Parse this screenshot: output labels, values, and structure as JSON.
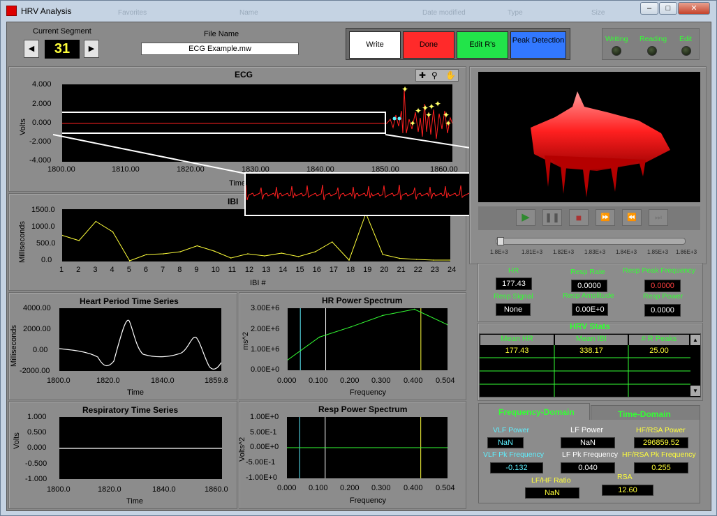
{
  "window": {
    "title": "HRV Analysis",
    "ghost": {
      "favorites": "Favorites",
      "name": "Name",
      "date": "Date modified",
      "type": "Type",
      "size": "Size"
    }
  },
  "top": {
    "current_segment_label": "Current Segment",
    "segment": "31",
    "file_name_label": "File Name",
    "file_name": "ECG Example.mw",
    "buttons": {
      "write": "Write",
      "done": "Done",
      "edit": "Edit R's",
      "peak": "Peak Detection"
    },
    "leds": {
      "writing": "Writing",
      "reading": "Reading",
      "edit": "Edit"
    }
  },
  "ecg": {
    "title": "ECG",
    "ylabel": "Volts",
    "xlabel": "Time",
    "yticks": [
      "4.000",
      "2.000",
      "0.000",
      "-2.000",
      "-4.000"
    ],
    "xticks": [
      "1800.00",
      "1810.00",
      "1820.00",
      "1830.00",
      "1840.00",
      "1850.00",
      "1860.00"
    ]
  },
  "ibi": {
    "title": "IBI",
    "ylabel": "Milliseconds",
    "xlabel": "IBI #",
    "yticks": [
      "1500.0",
      "1000.0",
      "500.0",
      "0.0"
    ]
  },
  "hp": {
    "title": "Heart Period Time Series",
    "ylabel": "Milliseconds",
    "xlabel": "Time",
    "yticks": [
      "4000.00",
      "2000.00",
      "0.00",
      "-2000.00"
    ],
    "xticks": [
      "1800.0",
      "1820.0",
      "1840.0",
      "1859.8"
    ]
  },
  "hrps": {
    "title": "HR Power Spectrum",
    "ylabel": "ms^2",
    "xlabel": "Frequency",
    "yticks": [
      "3.00E+6",
      "2.00E+6",
      "1.00E+6",
      "0.00E+0"
    ],
    "xticks": [
      "0.000",
      "0.100",
      "0.200",
      "0.300",
      "0.400",
      "0.504"
    ]
  },
  "resp": {
    "title": "Respiratory Time Series",
    "ylabel": "Volts",
    "xlabel": "Time",
    "yticks": [
      "1.000",
      "0.500",
      "0.000",
      "-0.500",
      "-1.000"
    ],
    "xticks": [
      "1800.0",
      "1820.0",
      "1840.0",
      "1860.0"
    ]
  },
  "rps": {
    "title": "Resp Power Spectrum",
    "ylabel": "Volts^2",
    "xlabel": "Frequency",
    "yticks": [
      "1.00E+0",
      "5.00E-1",
      "0.00E+0",
      "-5.00E-1",
      "-1.00E+0"
    ],
    "xticks": [
      "0.000",
      "0.100",
      "0.200",
      "0.300",
      "0.400",
      "0.504"
    ]
  },
  "slider": {
    "ticks": [
      "1.8E+3",
      "1.81E+3",
      "1.82E+3",
      "1.83E+3",
      "1.84E+3",
      "1.85E+3",
      "1.86E+3"
    ]
  },
  "metrics": {
    "hr_label": "HR",
    "hr": "177.43",
    "resp_rate_label": "Resp Rate",
    "resp_rate": "0.0000",
    "resp_peak_label": "Resp Peak Frequency",
    "resp_peak": "0.0000",
    "resp_signal_label": "Resp Signal",
    "resp_signal": "None",
    "resp_amp_label": "Resp Amplitude",
    "resp_amp": "0.00E+0",
    "resp_power_label": "Resp Power",
    "resp_power": "0.0000"
  },
  "hrv": {
    "title": "HRV Stats",
    "headers": [
      "Mean HR",
      "Mean IBI",
      "# R Peaks"
    ],
    "row": [
      "177.43",
      "338.17",
      "25.00"
    ]
  },
  "tabs": {
    "freq": "Frequency-Domain",
    "time": "Time-Domain"
  },
  "freq": {
    "vlf_power_label": "VLF  Power",
    "vlf_power": "NaN",
    "lf_power_label": "LF Power",
    "lf_power": "NaN",
    "hf_power_label": "HF/RSA Power",
    "hf_power": "296859.52",
    "vlf_pk_label": "VLF Pk Frequency",
    "vlf_pk": "-0.132",
    "lf_pk_label": "LF Pk Frequency",
    "lf_pk": "0.040",
    "hf_pk_label": "HF/RSA Pk Frequency",
    "hf_pk": "0.255",
    "lfhf_label": "LF/HF Ratio",
    "lfhf": "NaN",
    "rsa_label": "RSA",
    "rsa": "12.60"
  },
  "chart_data": [
    {
      "type": "line",
      "title": "IBI",
      "xlabel": "IBI #",
      "ylabel": "Milliseconds",
      "x": [
        1,
        2,
        3,
        4,
        5,
        6,
        7,
        8,
        9,
        10,
        11,
        12,
        13,
        14,
        15,
        16,
        17,
        18,
        19,
        20,
        21,
        22,
        23,
        24
      ],
      "y": [
        750,
        600,
        1150,
        850,
        20,
        200,
        220,
        280,
        450,
        300,
        100,
        220,
        160,
        240,
        140,
        280,
        560,
        40,
        1380,
        200,
        90,
        60,
        40,
        40
      ],
      "xlim": [
        1,
        24
      ],
      "ylim": [
        0,
        1500
      ]
    },
    {
      "type": "line",
      "title": "HR Power Spectrum",
      "xlabel": "Frequency",
      "ylabel": "ms^2",
      "x": [
        0.0,
        0.1,
        0.2,
        0.3,
        0.4,
        0.504
      ],
      "y": [
        500000,
        1600000,
        2100000,
        2650000,
        2950000,
        2200000
      ],
      "xlim": [
        0,
        0.504
      ],
      "ylim": [
        0,
        3000000
      ],
      "markers": [
        0.04,
        0.12,
        0.42
      ]
    },
    {
      "type": "line",
      "title": "Resp Power Spectrum",
      "xlabel": "Frequency",
      "ylabel": "Volts^2",
      "x": [
        0,
        0.504
      ],
      "y": [
        0,
        0
      ],
      "xlim": [
        0,
        0.504
      ],
      "ylim": [
        -1,
        1
      ],
      "markers": [
        0.04,
        0.12,
        0.42
      ]
    }
  ]
}
